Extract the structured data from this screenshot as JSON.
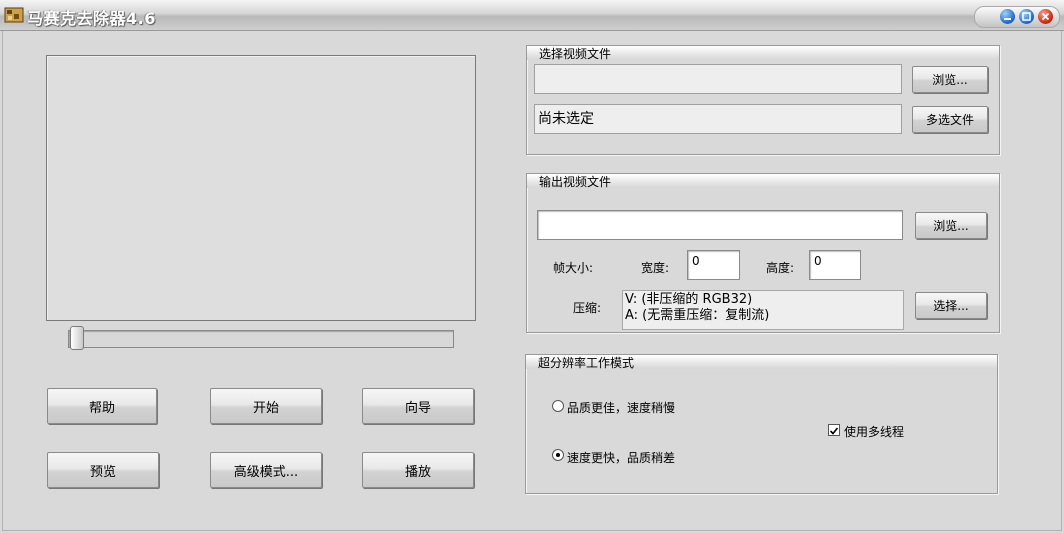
{
  "window": {
    "title": "马赛克去除器4.6",
    "controls": [
      "minimize-icon",
      "maximize-icon",
      "close-icon"
    ]
  },
  "preview": {
    "slider_position": 0
  },
  "buttons": {
    "help": "帮助",
    "start": "开始",
    "wizard": "向导",
    "preview": "预览",
    "advanced": "高级模式...",
    "play": "播放"
  },
  "input_group": {
    "title": "选择视频文件",
    "path_value": "",
    "browse": "浏览...",
    "status": "尚未选定",
    "multi_select": "多选文件"
  },
  "output_group": {
    "title": "输出视频文件",
    "path_value": "",
    "browse": "浏览...",
    "frame_size_label": "帧大小:",
    "width_label": "宽度:",
    "width_value": "0",
    "height_label": "高度:",
    "height_value": "0",
    "compress_label": "压缩:",
    "compress_video": "V: (非压缩的 RGB32)",
    "compress_audio": "A: (无需重压缩：复制流)",
    "choose": "选择..."
  },
  "sr_group": {
    "title": "超分辨率工作模式",
    "option_quality": "品质更佳，速度稍慢",
    "option_speed": "速度更快，品质稍差",
    "selected": "option_speed",
    "multithread_label": "使用多线程",
    "multithread_checked": true
  }
}
